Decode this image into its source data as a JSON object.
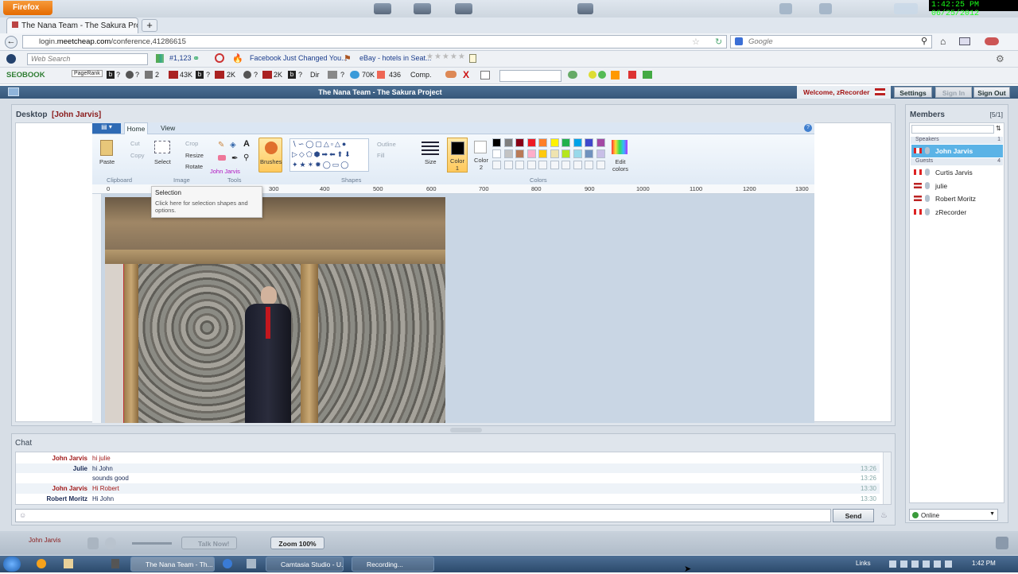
{
  "browser": {
    "menu_button": "Firefox",
    "clock": "1:42:25 PM 06/25/2012",
    "tab_title": "The Nana Team - The Sakura Project - C...",
    "url_prefix": "login.",
    "url_domain": "meetcheap.com",
    "url_path": "/conference,41286615",
    "search_placeholder": "Google"
  },
  "toolbar1": {
    "search_placeholder": "Web Search",
    "rank": "#1,123",
    "fb_link": "Facebook Just Changed You...",
    "ebay_link": "eBay - hotels in Seat..."
  },
  "toolbar2": {
    "brand": "SEOBOOK",
    "pagerank": "PageRank",
    "items": [
      "?",
      "?",
      "2",
      "43K",
      "?",
      "2K",
      "?",
      "2K",
      "?",
      "Dir",
      "?",
      "70K",
      "436",
      "Comp."
    ]
  },
  "app": {
    "title": "The Nana Team - The Sakura Project",
    "welcome": "Welcome, zRecorder",
    "settings": "Settings",
    "sign_in": "Sign In",
    "sign_out": "Sign Out"
  },
  "desktop": {
    "label": "Desktop",
    "presenter": "[John Jarvis]"
  },
  "paint": {
    "tabs": [
      "Home",
      "View"
    ],
    "paste": "Paste",
    "cut": "Cut",
    "copy": "Copy",
    "clipboard": "Clipboard",
    "select": "Select",
    "crop": "Crop",
    "resize": "Resize",
    "rotate": "Rotate",
    "image": "Image",
    "tools": "Tools",
    "brushes": "Brushes",
    "shapes": "Shapes",
    "outline": "Outline",
    "fill": "Fill",
    "size": "Size",
    "color1": "Color 1",
    "color2": "Color 2",
    "edit_colors": "Edit colors",
    "colors": "Colors",
    "cursor_label": "John Jarvis",
    "tooltip_title": "Selection",
    "tooltip_body": "Click here for selection shapes and options.",
    "ruler": [
      "0",
      "300",
      "400",
      "500",
      "600",
      "700",
      "800",
      "900",
      "1000",
      "1100",
      "1200",
      "1300"
    ],
    "palette": [
      "#000000",
      "#7f7f7f",
      "#880015",
      "#ed1c24",
      "#ff7f27",
      "#fff200",
      "#22b14c",
      "#00a2e8",
      "#3f48cc",
      "#a349a4",
      "#ffffff",
      "#c3c3c3",
      "#b97a57",
      "#ffaec9",
      "#ffc90e",
      "#efe4b0",
      "#b5e61d",
      "#99d9ea",
      "#7092be",
      "#c8bfe7"
    ]
  },
  "members": {
    "title": "Members",
    "count": "[5/1]",
    "speakers_label": "Speakers",
    "speakers_count": "1",
    "guests_label": "Guests",
    "guests_count": "4",
    "speakers": [
      {
        "name": "John Jarvis",
        "flag": "ca"
      }
    ],
    "guests": [
      {
        "name": "Curtis Jarvis",
        "flag": "ca"
      },
      {
        "name": "julie",
        "flag": "us"
      },
      {
        "name": "Robert Moritz",
        "flag": "us"
      },
      {
        "name": "zRecorder",
        "flag": "ca"
      }
    ],
    "status": "Online"
  },
  "chat": {
    "title": "Chat",
    "send": "Send",
    "messages": [
      {
        "sender": "John Jarvis",
        "text": "hi julie",
        "time": "",
        "color": "#a01818"
      },
      {
        "sender": "Julie",
        "text": "hi John",
        "time": "13:26",
        "color": "#1a2a55"
      },
      {
        "sender": "",
        "text": "sounds good",
        "time": "13:26",
        "color": "#1a2a55"
      },
      {
        "sender": "John Jarvis",
        "text": "Hi Robert",
        "time": "13:30",
        "color": "#a01818"
      },
      {
        "sender": "Robert Moritz",
        "text": "Hi John",
        "time": "13:30",
        "color": "#1a2a55"
      }
    ]
  },
  "bottom": {
    "user": "John Jarvis",
    "talk": "Talk Now!",
    "zoom": "Zoom 100%"
  },
  "taskbar": {
    "items": [
      "The Nana Team - Th...",
      "Camtasia Studio - U...",
      "Recording..."
    ],
    "links": "Links",
    "time": "1:42 PM"
  }
}
